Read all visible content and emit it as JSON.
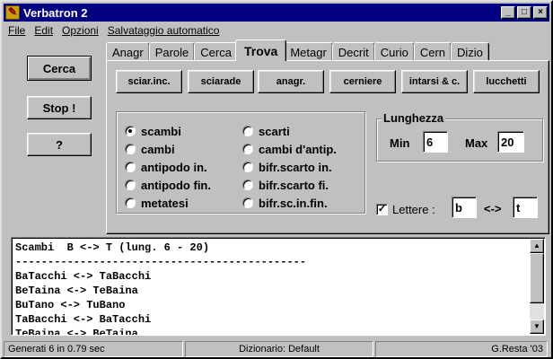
{
  "window": {
    "title": "Verbatron 2",
    "min_glyph": "_",
    "max_glyph": "□",
    "close_glyph": "×"
  },
  "menu": [
    "File",
    "Edit",
    "Opzioni",
    "Salvataggio automatico"
  ],
  "left_buttons": {
    "search": "Cerca",
    "stop": "Stop !",
    "help": "?"
  },
  "tabs": [
    "Anagr",
    "Parole",
    "Cerca",
    "Trova",
    "Metagr",
    "Decrit",
    "Curio",
    "Cern",
    "Dizio"
  ],
  "active_tab": "Trova",
  "sub_buttons": [
    "sciar.inc.",
    "sciarade",
    "anagr.",
    "cerniere",
    "intarsi & c.",
    "lucchetti"
  ],
  "options_left": [
    "scambi",
    "cambi",
    "antipodo in.",
    "antipodo fin.",
    "metatesi"
  ],
  "options_right": [
    "scarti",
    "cambi d'antip.",
    "bifr.scarto in.",
    "bifr.scarto fi.",
    "bifr.sc.in.fin."
  ],
  "selected_option": "scambi",
  "length": {
    "legend": "Lunghezza",
    "min_label": "Min",
    "min_value": "6",
    "max_label": "Max",
    "max_value": "20"
  },
  "letters": {
    "checked": true,
    "check_glyph": "✓",
    "label": "Lettere :",
    "from": "b",
    "arrow": "<->",
    "to": "t"
  },
  "output_lines": [
    "Scambi  B <-> T (lung. 6 - 20)",
    "---------------------------------------------",
    "BaTacchi <-> TaBacchi",
    "BeTaina <-> TeBaina",
    "BuTano <-> TuBano",
    "TaBacchi <-> BaTacchi",
    "TeBaina <-> BeTaina"
  ],
  "scroll_up": "▲",
  "scroll_down": "▼",
  "status": {
    "generated": "Generati 6 in 0.79 sec",
    "dictionary": "Dizionario: Default",
    "author": "G.Resta '03"
  }
}
